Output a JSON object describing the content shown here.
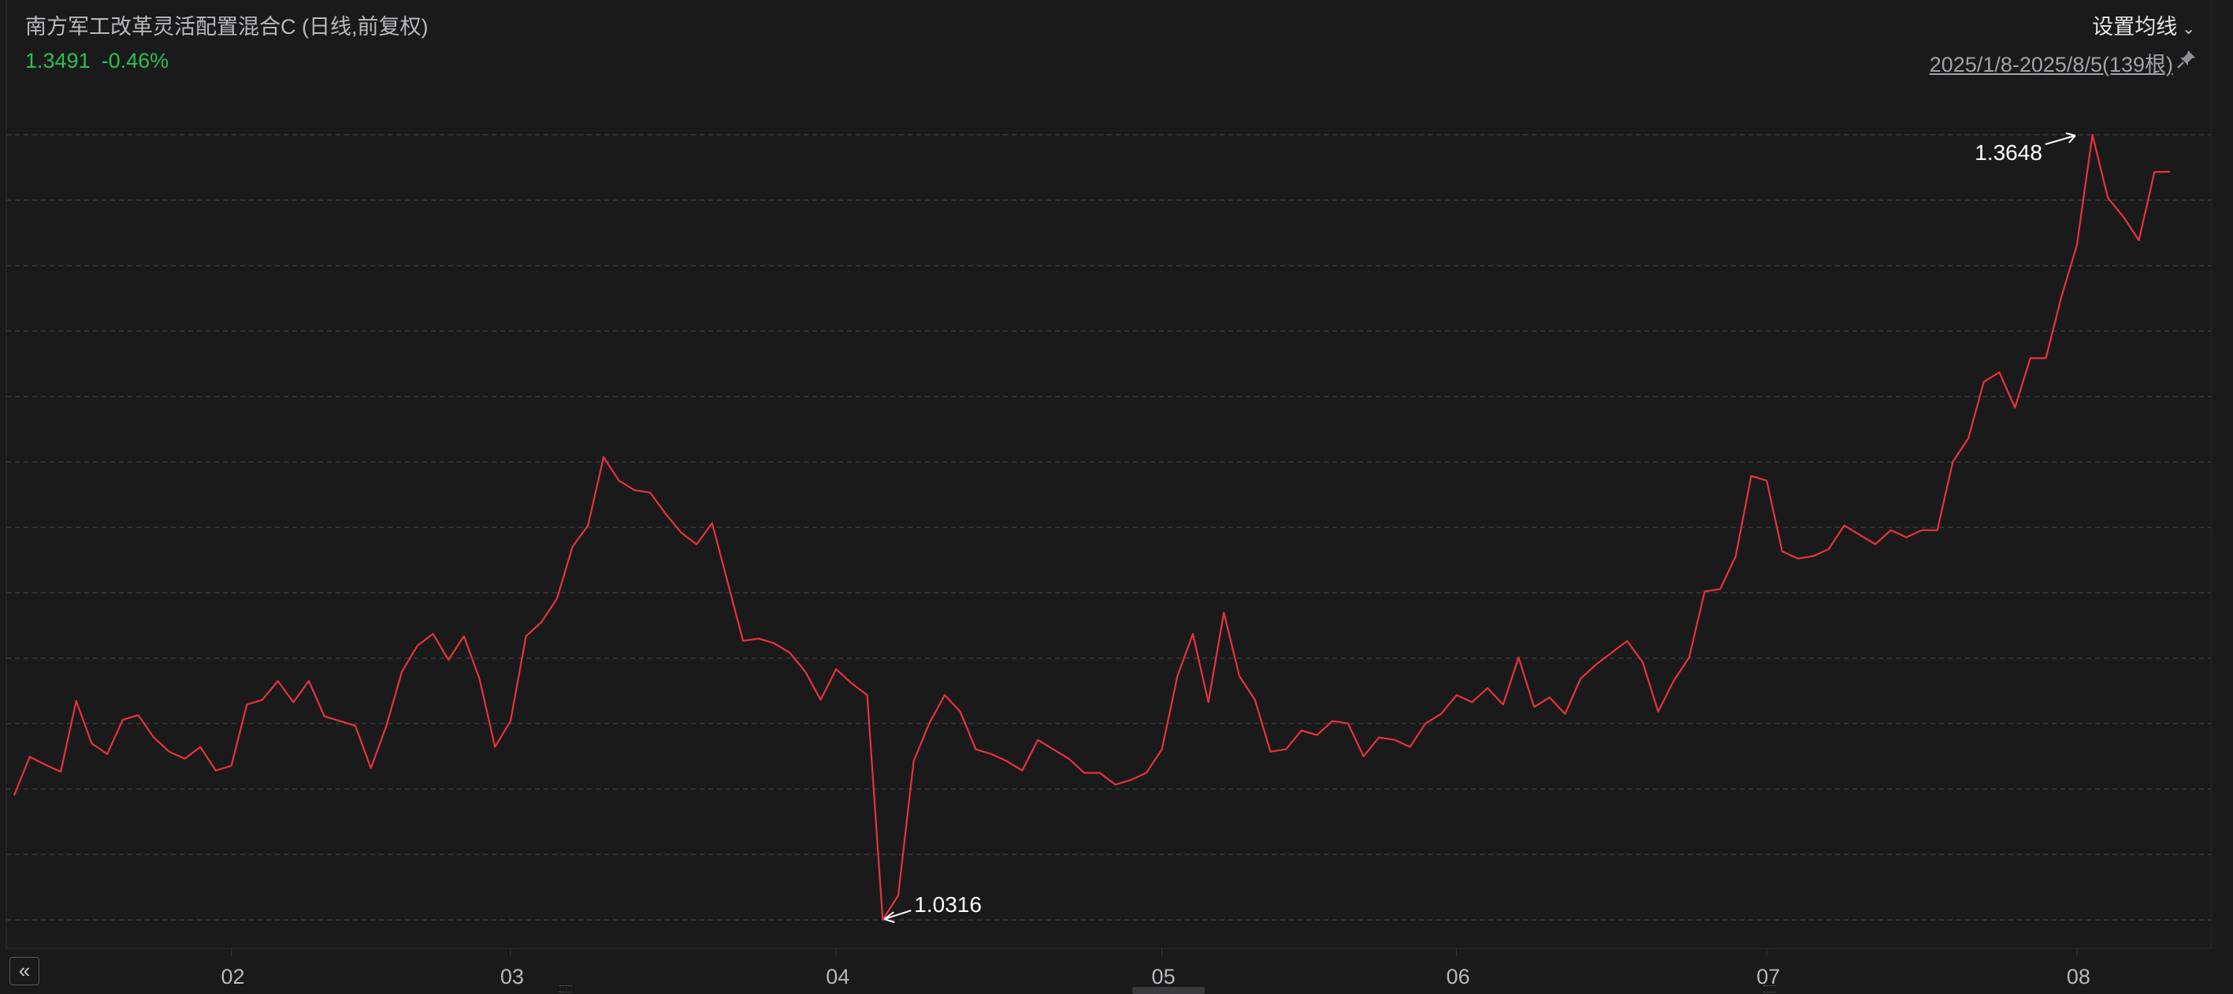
{
  "header": {
    "title": "南方军工改革灵活配置混合C (日线,前复权)",
    "price": "1.3491",
    "change": "-0.46%",
    "ma_settings_label": "设置均线",
    "range_label": "2025/1/8-2025/8/5(139根)"
  },
  "colors": {
    "background": "#1a1a1b",
    "line": "#e8323c",
    "down": "#2cbf52",
    "grid": "#3a3a3d",
    "text": "#b9b9bd"
  },
  "chart_data": {
    "type": "line",
    "title": "南方军工改革灵活配置混合C (日线,前复权)",
    "series": [
      {
        "values": [
          1.0845,
          1.1008,
          1.0975,
          1.0945,
          1.1245,
          1.1065,
          1.102,
          1.1165,
          1.1185,
          1.109,
          1.103,
          1.1,
          1.105,
          1.095,
          1.097,
          1.123,
          1.125,
          1.133,
          1.124,
          1.133,
          1.118,
          1.116,
          1.114,
          1.096,
          1.114,
          1.137,
          1.148,
          1.153,
          1.142,
          1.152,
          1.134,
          1.105,
          1.116,
          1.152,
          1.158,
          1.168,
          1.19,
          1.199,
          1.228,
          1.218,
          1.214,
          1.213,
          1.204,
          1.196,
          1.191,
          1.2,
          1.175,
          1.15,
          1.151,
          1.149,
          1.145,
          1.137,
          1.125,
          1.138,
          1.132,
          1.127,
          1.0316,
          1.042,
          1.099,
          1.115,
          1.127,
          1.12,
          1.104,
          1.102,
          1.099,
          1.095,
          1.108,
          1.104,
          1.1,
          1.094,
          1.094,
          1.089,
          1.091,
          1.094,
          1.104,
          1.135,
          1.153,
          1.124,
          1.162,
          1.135,
          1.125,
          1.103,
          1.104,
          1.112,
          1.11,
          1.116,
          1.115,
          1.101,
          1.109,
          1.108,
          1.105,
          1.115,
          1.119,
          1.127,
          1.124,
          1.13,
          1.123,
          1.143,
          1.122,
          1.126,
          1.119,
          1.134,
          1.14,
          1.145,
          1.15,
          1.141,
          1.12,
          1.133,
          1.143,
          1.171,
          1.172,
          1.186,
          1.22,
          1.218,
          1.188,
          1.185,
          1.186,
          1.189,
          1.199,
          1.195,
          1.191,
          1.197,
          1.194,
          1.197,
          1.197,
          1.226,
          1.236,
          1.26,
          1.264,
          1.249,
          1.27,
          1.27,
          1.296,
          1.318,
          1.3648,
          1.338,
          1.33,
          1.32,
          1.349,
          1.3491
        ]
      }
    ],
    "x_ticks": [
      "02",
      "03",
      "04",
      "05",
      "06",
      "07",
      "08"
    ],
    "x_tick_index": [
      14,
      32,
      53,
      74,
      93,
      113,
      133
    ],
    "ylim": [
      1.0316,
      1.3648
    ],
    "max": {
      "value": "1.3648",
      "index": 133
    },
    "min": {
      "value": "1.0316",
      "index": 56
    },
    "grid": true
  }
}
